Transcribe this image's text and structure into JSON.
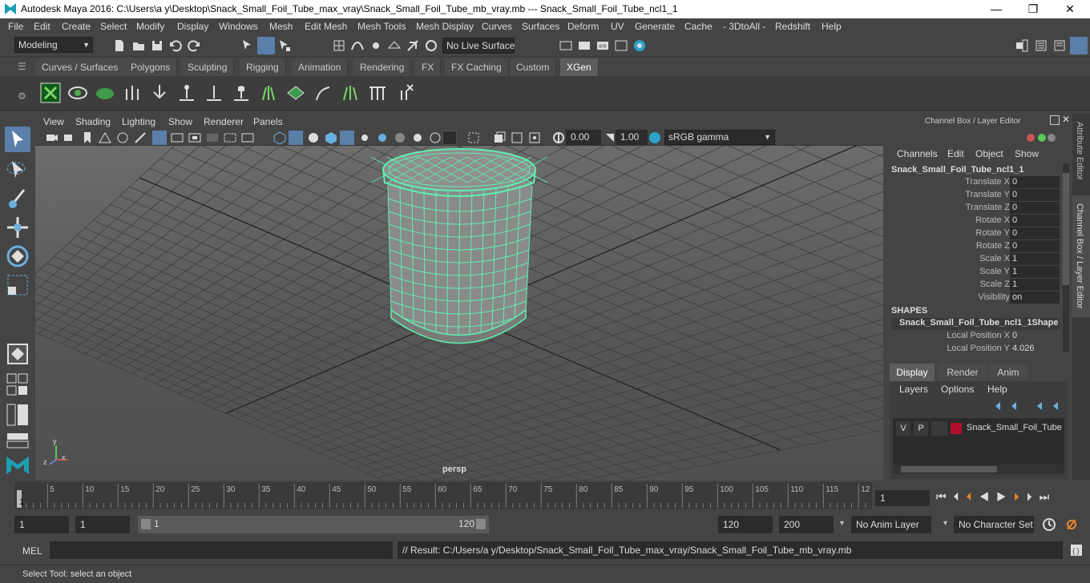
{
  "window": {
    "title": "Autodesk Maya 2016: C:\\Users\\a y\\Desktop\\Snack_Small_Foil_Tube_max_vray\\Snack_Small_Foil_Tube_mb_vray.mb   ---   Snack_Small_Foil_Tube_ncl1_1",
    "minimize": "—",
    "maximize": "❐",
    "close": "✕"
  },
  "menu": [
    "File",
    "Edit",
    "Create",
    "Select",
    "Modify",
    "Display",
    "Windows",
    "Mesh",
    "Edit Mesh",
    "Mesh Tools",
    "Mesh Display",
    "Curves",
    "Surfaces",
    "Deform",
    "UV",
    "Generate",
    "Cache",
    "- 3DtoAll -",
    "Redshift",
    "Help"
  ],
  "status": {
    "mode": "Modeling",
    "live_surface": "No Live Surface"
  },
  "shelf_tabs": [
    "Curves / Surfaces",
    "Polygons",
    "Sculpting",
    "Rigging",
    "Animation",
    "Rendering",
    "FX",
    "FX Caching",
    "Custom",
    "XGen"
  ],
  "viewport": {
    "menu": [
      "View",
      "Shading",
      "Lighting",
      "Show",
      "Renderer",
      "Panels"
    ],
    "field1": "0.00",
    "field2": "1.00",
    "color_space": "sRGB gamma",
    "camera": "persp"
  },
  "channel_box": {
    "header": "Channel Box / Layer Editor",
    "menu": [
      "Channels",
      "Edit",
      "Object",
      "Show"
    ],
    "object": "Snack_Small_Foil_Tube_ncl1_1",
    "attrs": [
      {
        "l": "Translate X",
        "v": "0"
      },
      {
        "l": "Translate Y",
        "v": "0"
      },
      {
        "l": "Translate Z",
        "v": "0"
      },
      {
        "l": "Rotate X",
        "v": "0"
      },
      {
        "l": "Rotate Y",
        "v": "0"
      },
      {
        "l": "Rotate Z",
        "v": "0"
      },
      {
        "l": "Scale X",
        "v": "1"
      },
      {
        "l": "Scale Y",
        "v": "1"
      },
      {
        "l": "Scale Z",
        "v": "1"
      },
      {
        "l": "Visibility",
        "v": "on"
      }
    ],
    "shapes_label": "SHAPES",
    "shape_name": "Snack_Small_Foil_Tube_ncl1_1Shape",
    "shape_attrs": [
      {
        "l": "Local Position X",
        "v": "0"
      },
      {
        "l": "Local Position Y",
        "v": "4.026"
      }
    ]
  },
  "layer_editor": {
    "tabs": [
      "Display",
      "Render",
      "Anim"
    ],
    "menu": [
      "Layers",
      "Options",
      "Help"
    ],
    "v": "V",
    "p": "P",
    "layer_name": "Snack_Small_Foil_Tube",
    "layer_color": "#b0102a"
  },
  "side_tabs": {
    "attr": "Attribute Editor",
    "channel": "Channel Box / Layer Editor"
  },
  "timeline": {
    "ticks": [
      "5",
      "10",
      "15",
      "20",
      "25",
      "30",
      "35",
      "40",
      "45",
      "50",
      "55",
      "60",
      "65",
      "70",
      "75",
      "80",
      "85",
      "90",
      "95",
      "100",
      "105",
      "110",
      "115",
      "12"
    ],
    "current": "1",
    "frame_field": "1"
  },
  "range": {
    "start": "1",
    "start2": "1",
    "slider_start": "1",
    "slider_end": "120",
    "end": "120",
    "end2": "200",
    "anim_layer": "No Anim Layer",
    "char_set": "No Character Set"
  },
  "cmd": {
    "mel": "MEL",
    "result": "// Result: C:/Users/a y/Desktop/Snack_Small_Foil_Tube_max_vray/Snack_Small_Foil_Tube_mb_vray.mb"
  },
  "help": "Select Tool: select an object"
}
